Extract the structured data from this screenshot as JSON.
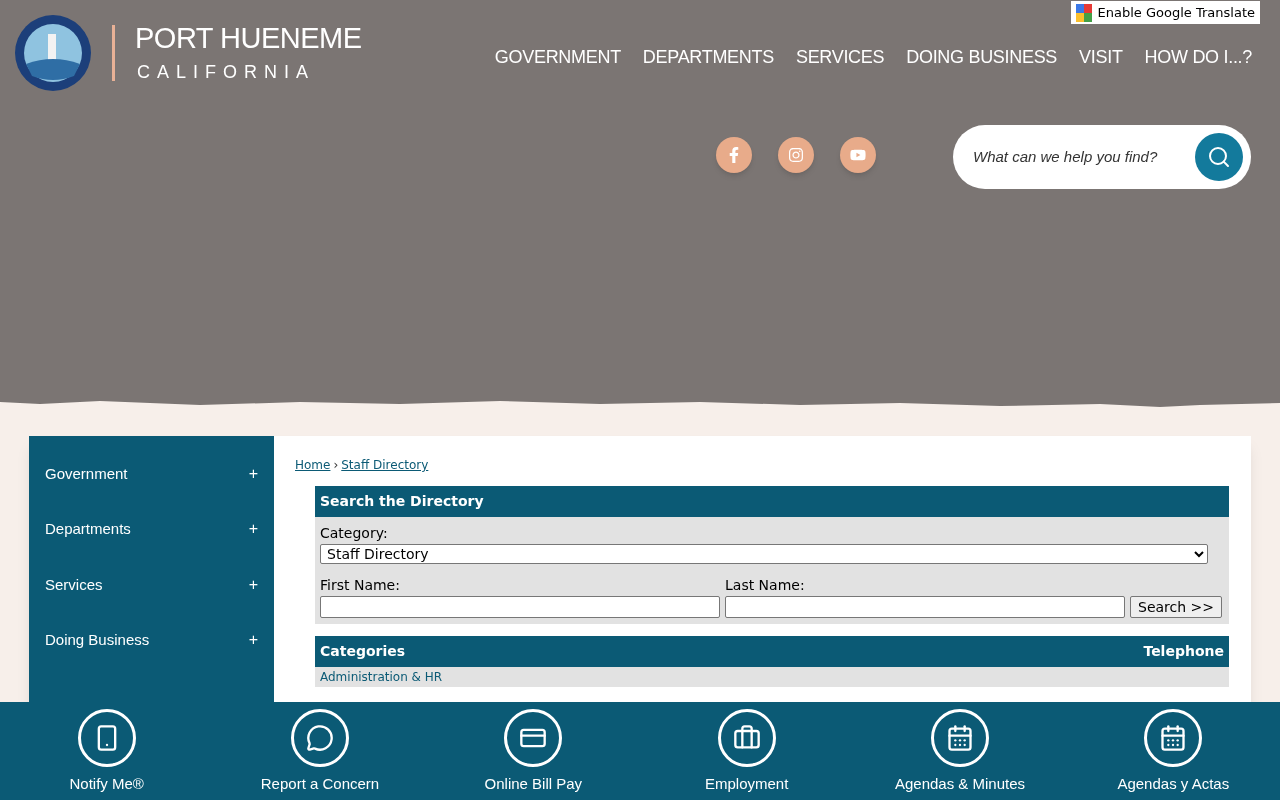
{
  "translate": {
    "label": "Enable Google Translate"
  },
  "logo": {
    "title": "PORT HUENEME",
    "subtitle": "CALIFORNIA"
  },
  "nav": [
    "GOVERNMENT",
    "DEPARTMENTS",
    "SERVICES",
    "DOING BUSINESS",
    "VISIT",
    "HOW DO I...?"
  ],
  "social": [
    {
      "kind": "facebook"
    },
    {
      "kind": "instagram"
    },
    {
      "kind": "youtube"
    }
  ],
  "search": {
    "placeholder": "What can we help you find?"
  },
  "sidebar": {
    "items": [
      {
        "label": "Government",
        "toggle": "+"
      },
      {
        "label": "Departments",
        "toggle": "+"
      },
      {
        "label": "Services",
        "toggle": "+"
      },
      {
        "label": "Doing Business",
        "toggle": "+"
      }
    ]
  },
  "breadcrumb": [
    {
      "label": "Home"
    },
    {
      "label": "Staff Directory"
    }
  ],
  "breadcrumb_separator": "›",
  "directory_search": {
    "title": "Search the Directory",
    "category_label": "Category:",
    "category_value": "Staff Directory",
    "first_name_label": "First Name:",
    "last_name_label": "Last Name:",
    "button": "Search >>"
  },
  "table": {
    "columns": [
      "Categories",
      "Telephone"
    ],
    "rows": [
      "Administration & HR"
    ]
  },
  "quick_links": [
    {
      "kind": "phone",
      "label": "Notify Me®"
    },
    {
      "kind": "chat",
      "label": "Report a Concern"
    },
    {
      "kind": "card",
      "label": "Online Bill Pay"
    },
    {
      "kind": "briefcase",
      "label": "Employment"
    },
    {
      "kind": "calendar",
      "label": "Agendas & Minutes"
    },
    {
      "kind": "calendar",
      "label": "Agendas y Actas"
    }
  ]
}
